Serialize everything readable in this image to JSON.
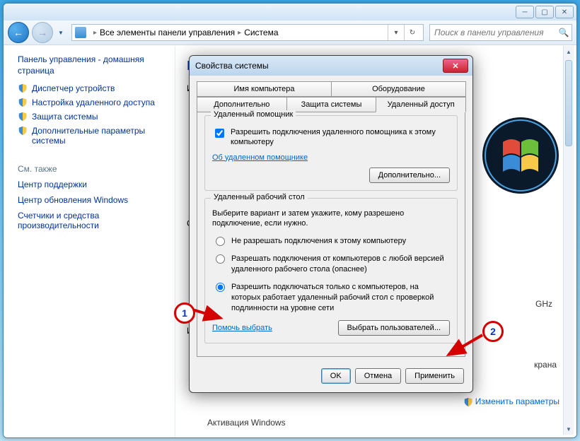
{
  "nav": {
    "crumb1": "Все элементы панели управления",
    "crumb2": "Система",
    "search_placeholder": "Поиск в панели управления"
  },
  "sidebar": {
    "heading": "Панель управления - домашняя страница",
    "links": [
      "Диспетчер устройств",
      "Настройка удаленного доступа",
      "Защита системы",
      "Дополнительные параметры системы"
    ],
    "see_also_label": "См. также",
    "see_also": [
      "Центр поддержки",
      "Центр обновления Windows",
      "Счетчики и средства производительности"
    ]
  },
  "main": {
    "heading_frag": "П",
    "sub_frag": "Из",
    "si": "Си",
    "in": "Ин",
    "ghz": "GHz",
    "ekrana": "крана",
    "change": "Изменить параметры",
    "activation": "Активация Windows"
  },
  "dialog": {
    "title": "Свойства системы",
    "tabs_row1": [
      "Имя компьютера",
      "Оборудование"
    ],
    "tabs_row2": [
      "Дополнительно",
      "Защита системы",
      "Удаленный доступ"
    ],
    "group1_title": "Удаленный помощник",
    "allow_assist": "Разрешить подключения удаленного помощника к этому компьютеру",
    "assist_link": "Об удаленном помощнике",
    "advanced_btn": "Дополнительно...",
    "group2_title": "Удаленный рабочий стол",
    "desc": "Выберите вариант и затем укажите, кому разрешено подключение, если нужно.",
    "r1": "Не разрешать подключения к этому компьютеру",
    "r2": "Разрешать подключения от компьютеров с любой версией удаленного рабочего стола (опаснее)",
    "r3": "Разрешить подключаться только с компьютеров, на которых работает удаленный рабочий стол с проверкой подлинности на уровне сети",
    "help_link": "Помочь выбрать",
    "select_users": "Выбрать пользователей...",
    "ok": "OK",
    "cancel": "Отмена",
    "apply": "Применить"
  },
  "annot": {
    "n1": "1",
    "n2": "2"
  }
}
